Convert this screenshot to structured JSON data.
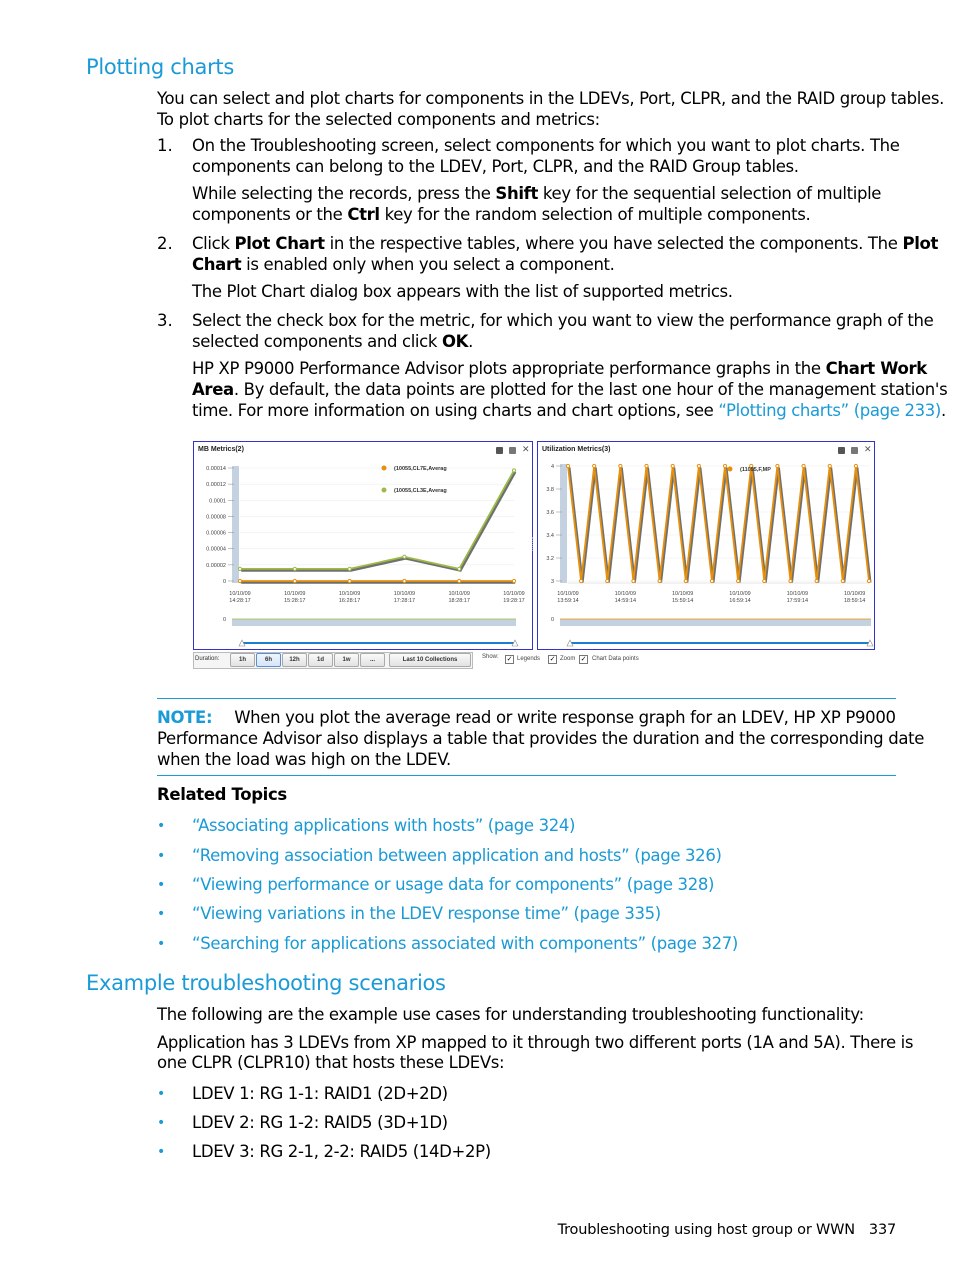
{
  "section1": {
    "title": "Plotting charts",
    "intro_line1": "You can select and plot charts for components in the LDEVs, Port, CLPR, and the RAID group tables.",
    "intro_line2": "To plot charts for the selected components and metrics:",
    "steps": [
      {
        "number": "1.",
        "line1": "On the Troubleshooting screen, select components for which you want to plot charts. The",
        "line2": "components can belong to the LDEV, Port, CLPR, and the RAID Group tables.",
        "sub_a": "While selecting the records, press the ",
        "sub_b": "Shift",
        "sub_c": " key for the sequential selection of multiple",
        "sub_d": "components or the ",
        "sub_e": "Ctrl",
        "sub_f": " key for the random selection of multiple components."
      },
      {
        "number": "2.",
        "a": "Click ",
        "b": "Plot Chart",
        "c": " in the respective tables, where you have selected the components. The ",
        "d": "Plot",
        "e": "Chart",
        "f": " is enabled only when you select a component.",
        "sub": "The Plot Chart dialog box appears with the list of supported metrics."
      },
      {
        "number": "3.",
        "line1": "Select the check box for the metric, for which you want to view the performance graph of the",
        "line2a": "selected components and click ",
        "line2b": "OK",
        "line2c": ".",
        "sub1a": "HP XP P9000 Performance Advisor plots appropriate performance graphs in the ",
        "sub1b": "Chart Work",
        "sub2a": "Area",
        "sub2b": ". By default, the data points are plotted for the last one hour of the management station's",
        "sub3a": "time. For more information on using charts and chart options, see ",
        "sub3_link": "“Plotting charts” (page 233)",
        "sub3b": "."
      }
    ]
  },
  "screenshot": {
    "left_panel": {
      "title": "MB Metrics(2)",
      "legend": [
        "(10055,CL7E,Averag",
        "(10055,CL3E,Averag"
      ],
      "overview_zero": "0"
    },
    "right_panel": {
      "title": "Utilization Metrics(3)",
      "legend": [
        "(11095,F,MP"
      ],
      "overview_zero": "0"
    },
    "toolbar": {
      "duration_label": "Duration:",
      "buttons": [
        "1h",
        "6h",
        "12h",
        "1d",
        "1w",
        "...",
        "Last 10 Collections"
      ],
      "active": "6h",
      "show_label": "Show:",
      "checkboxes": [
        {
          "label": "Legends",
          "checked": true
        },
        {
          "label": "Zoom",
          "checked": true
        },
        {
          "label": "Chart Data points",
          "checked": true
        }
      ],
      "check_glyph": "✓"
    }
  },
  "chart_data": [
    {
      "type": "line",
      "title": "MB Metrics(2)",
      "x": [
        "10/10/09 14:28:17",
        "10/10/09 15:28:17",
        "10/10/09 16:28:17",
        "10/10/09 17:28:17",
        "10/10/09 18:28:17",
        "10/10/09 19:28:17"
      ],
      "x_labels": [
        [
          "10/10/09",
          "14:28:17"
        ],
        [
          "10/10/09",
          "15:28:17"
        ],
        [
          "10/10/09",
          "16:28:17"
        ],
        [
          "10/10/09",
          "17:28:17"
        ],
        [
          "10/10/09",
          "18:28:17"
        ],
        [
          "10/10/09",
          "19:28:17"
        ]
      ],
      "yticks": [
        "0",
        "0.00002",
        "0.00004",
        "0.00006",
        "0.00008",
        "0.0001",
        "0.00012",
        "0.00014"
      ],
      "ylim": [
        0,
        0.00014
      ],
      "series": [
        {
          "name": "(10055,CL7E,Averag",
          "color": "#e8900c",
          "values": [
            0,
            0,
            0,
            0,
            0,
            0
          ]
        },
        {
          "name": "(10055,CL3E,Averag",
          "color": "#9bbb44",
          "values": [
            1.5e-05,
            1.5e-05,
            1.5e-05,
            3e-05,
            1.5e-05,
            0.000137
          ]
        }
      ],
      "legend": "top-right",
      "grid": true
    },
    {
      "type": "line",
      "title": "Utilization Metrics(3)",
      "x_labels": [
        [
          "10/10/09",
          "13:59:14"
        ],
        [
          "10/10/09",
          "14:59:14"
        ],
        [
          "10/10/09",
          "15:59:14"
        ],
        [
          "10/10/09",
          "16:59:14"
        ],
        [
          "10/10/09",
          "17:59:14"
        ],
        [
          "10/10/09",
          "18:59:14"
        ]
      ],
      "yticks": [
        "3",
        "3.2",
        "3.4",
        "3.6",
        "3.8",
        "4"
      ],
      "ylim": [
        3,
        4
      ],
      "series": [
        {
          "name": "(11095,F,MP",
          "color": "#e8900c",
          "values": [
            4,
            3,
            4,
            3,
            4,
            3,
            4,
            3,
            4,
            3,
            4,
            3,
            4,
            3,
            4,
            3,
            4,
            3,
            4,
            3,
            4,
            3,
            4,
            3
          ]
        }
      ],
      "legend": "top-right",
      "grid": true
    }
  ],
  "note": {
    "label": "NOTE:",
    "line1": "When you plot the average read or write response graph for an LDEV, HP XP P9000",
    "line2": "Performance Advisor also displays a table that provides the duration and the corresponding date",
    "line3": "when the load was high on the LDEV."
  },
  "related": {
    "heading": "Related Topics",
    "links": [
      "“Associating applications with hosts” (page 324)",
      "“Removing association between application and hosts” (page 326)",
      "“Viewing performance or usage data for components” (page 328)",
      "“Viewing variations in the LDEV response time” (page 335)",
      "“Searching for applications associated with components” (page 327)"
    ]
  },
  "section2": {
    "title": "Example troubleshooting scenarios",
    "p1": "The following are the example use cases for understanding troubleshooting functionality:",
    "p2_line1": "Application has 3 LDEVs from XP mapped to it through two different ports (1A and 5A). There is",
    "p2_line2": "one CLPR (CLPR10) that hosts these LDEVs:",
    "items": [
      "LDEV 1: RG 1-1: RAID1 (2D+2D)",
      "LDEV 2: RG 1-2: RAID5 (3D+1D)",
      "LDEV 3: RG 2-1, 2-2: RAID5 (14D+2P)"
    ]
  },
  "footer": {
    "text": "Troubleshooting using host group or WWN",
    "page": "337"
  }
}
